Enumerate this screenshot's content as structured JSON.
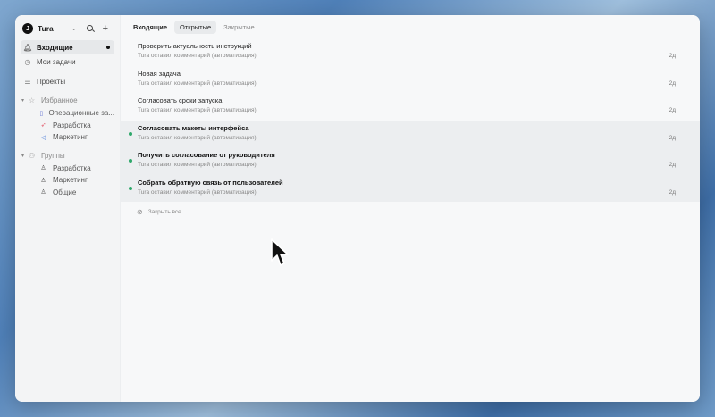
{
  "workspace": {
    "logo_letter": "J",
    "name": "Tura"
  },
  "nav": {
    "inbox": "Входящие",
    "my_tasks": "Мои задачи",
    "projects": "Проекты"
  },
  "favorites": {
    "header": "Избранное",
    "items": [
      {
        "label": "Операционные за...",
        "icon": "bookmark-icon",
        "color": "#6d7bd6"
      },
      {
        "label": "Разработка",
        "icon": "rocket-icon",
        "color": "#e25a6b"
      },
      {
        "label": "Маркетинг",
        "icon": "megaphone-icon",
        "color": "#4a7bd8"
      }
    ]
  },
  "groups": {
    "header": "Группы",
    "items": [
      {
        "label": "Разработка"
      },
      {
        "label": "Маркетинг"
      },
      {
        "label": "Общие"
      }
    ]
  },
  "tabs": [
    {
      "label": "Входящие"
    },
    {
      "label": "Открытые"
    },
    {
      "label": "Закрытые"
    }
  ],
  "notifications": [
    {
      "title": "Проверить актуальность инструкций",
      "subtitle": "Tura оставил комментарий (автоматизация)",
      "time": "2д",
      "unread": false
    },
    {
      "title": "Новая задача",
      "subtitle": "Tura оставил комментарий (автоматизация)",
      "time": "2д",
      "unread": false
    },
    {
      "title": "Согласовать сроки запуска",
      "subtitle": "Tura оставил комментарий (автоматизация)",
      "time": "2д",
      "unread": false
    },
    {
      "title": "Согласовать макеты интерфейса",
      "subtitle": "Tura оставил комментарий (автоматизация)",
      "time": "2д",
      "unread": true
    },
    {
      "title": "Получить согласование от руководителя",
      "subtitle": "Tura оставил комментарий (автоматизация)",
      "time": "2д",
      "unread": true
    },
    {
      "title": "Собрать обратную связь от пользователей",
      "subtitle": "Tura оставил комментарий (автоматизация)",
      "time": "2д",
      "unread": true
    }
  ],
  "close_all_label": "Закрыть все",
  "colors": {
    "unread_dot": "#2fa86b",
    "accent": "#111111"
  }
}
